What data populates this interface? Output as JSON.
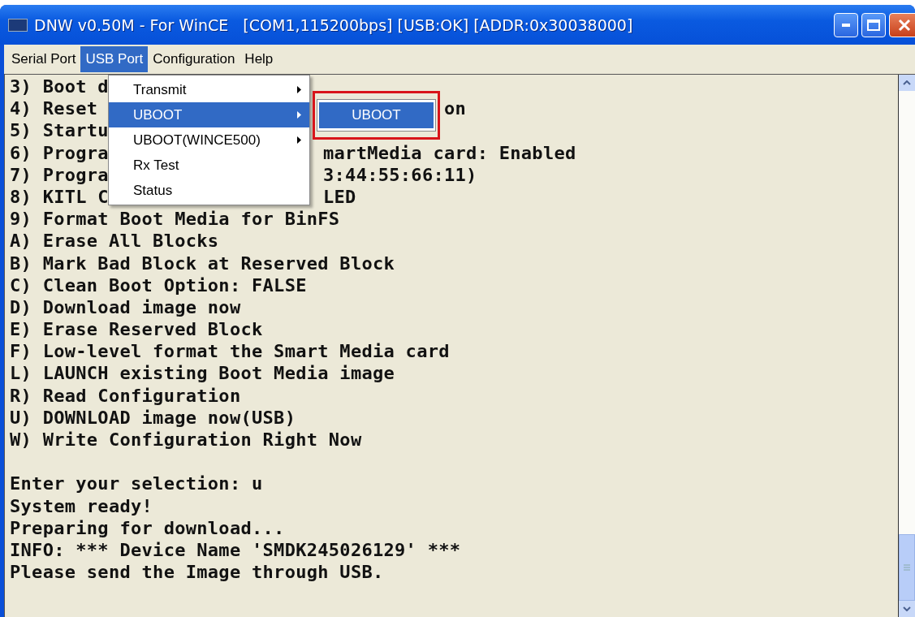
{
  "window": {
    "title": "DNW v0.50M - For WinCE   [COM1,115200bps] [USB:OK] [ADDR:0x30038000]"
  },
  "menu_bar": [
    {
      "label": "Serial Port",
      "selected": false
    },
    {
      "label": "USB Port",
      "selected": true
    },
    {
      "label": "Configuration",
      "selected": false
    },
    {
      "label": "Help",
      "selected": false
    }
  ],
  "dropdown": {
    "items": [
      {
        "label": "Transmit",
        "has_submenu": true,
        "selected": false
      },
      {
        "label": "UBOOT",
        "has_submenu": true,
        "selected": true
      },
      {
        "label": "UBOOT(WINCE500)",
        "has_submenu": true,
        "selected": false
      },
      {
        "label": "Rx Test",
        "has_submenu": false,
        "selected": false
      },
      {
        "label": "Status",
        "has_submenu": false,
        "selected": false
      }
    ]
  },
  "submenu": {
    "items": [
      {
        "label": "UBOOT",
        "selected": true
      }
    ]
  },
  "terminal": {
    "lines": [
      {
        "kind": "text",
        "text": "3) Boot d"
      },
      {
        "kind": "split_submenu",
        "text": "4) Reset",
        "tail": "on"
      },
      {
        "kind": "text",
        "text": "5) Startu"
      },
      {
        "kind": "split_menu",
        "text": "6) Progra",
        "tail": "martMedia card: Enabled"
      },
      {
        "kind": "split_menu",
        "text": "7) Progra",
        "tail": "3:44:55:66:11)"
      },
      {
        "kind": "split_menu",
        "text": "8) KITL C",
        "tail": "LED"
      },
      {
        "kind": "text",
        "text": "9) Format Boot Media for BinFS"
      },
      {
        "kind": "text",
        "text": "A) Erase All Blocks"
      },
      {
        "kind": "text",
        "text": "B) Mark Bad Block at Reserved Block"
      },
      {
        "kind": "text",
        "text": "C) Clean Boot Option: FALSE"
      },
      {
        "kind": "text",
        "text": "D) Download image now"
      },
      {
        "kind": "text",
        "text": "E) Erase Reserved Block"
      },
      {
        "kind": "text",
        "text": "F) Low-level format the Smart Media card"
      },
      {
        "kind": "text",
        "text": "L) LAUNCH existing Boot Media image"
      },
      {
        "kind": "text",
        "text": "R) Read Configuration"
      },
      {
        "kind": "text",
        "text": "U) DOWNLOAD image now(USB)"
      },
      {
        "kind": "text",
        "text": "W) Write Configuration Right Now"
      },
      {
        "kind": "blank"
      },
      {
        "kind": "text",
        "text": "Enter your selection: u"
      },
      {
        "kind": "text",
        "text": "System ready!"
      },
      {
        "kind": "text",
        "text": "Preparing for download..."
      },
      {
        "kind": "text",
        "text": "INFO: *** Device Name 'SMDK245026129' ***"
      },
      {
        "kind": "text",
        "text": "Please send the Image through USB."
      }
    ]
  }
}
